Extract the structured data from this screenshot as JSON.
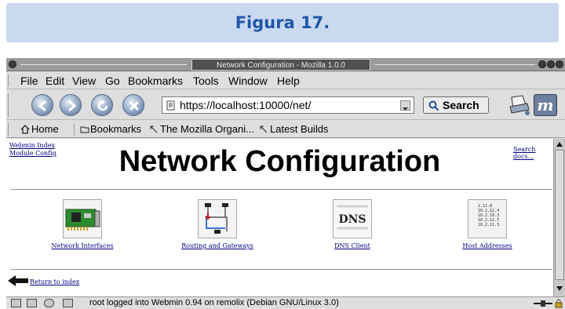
{
  "figure": {
    "caption": "Figura 17."
  },
  "window": {
    "title": "Network Configuration - Mozilla 1.0.0"
  },
  "menu": {
    "items": [
      {
        "label": "File",
        "key": "file"
      },
      {
        "label": "Edit",
        "key": "edit"
      },
      {
        "label": "View",
        "key": "view"
      },
      {
        "label": "Go",
        "key": "go"
      },
      {
        "label": "Bookmarks",
        "key": "bookmarks"
      },
      {
        "label": "Tools",
        "key": "tools"
      },
      {
        "label": "Window",
        "key": "window"
      },
      {
        "label": "Help",
        "key": "help"
      }
    ]
  },
  "navigation": {
    "url": "https://localhost:10000/net/",
    "search_label": "Search",
    "buttons": [
      "back-arrow-icon",
      "forward-arrow-icon",
      "reload-icon",
      "stop-icon"
    ]
  },
  "personal_toolbar": {
    "home": "Home",
    "bookmarks": "Bookmarks",
    "mozilla_org": "The Mozilla Organi...",
    "latest_builds": "Latest Builds"
  },
  "page": {
    "webmin_index": "Webmin Index",
    "module_config": "Module Config",
    "search_docs": "Search docs...",
    "title": "Network Configuration",
    "modules": [
      {
        "label": "Network Interfaces",
        "icon": "network-card-icon"
      },
      {
        "label": "Routing and Gateways",
        "icon": "routing-icon"
      },
      {
        "label": "DNS Client",
        "icon": "dns-icon",
        "icon_text": "DNS"
      },
      {
        "label": "Host Addresses",
        "icon": "host-addresses-icon",
        "icon_lines": [
          "2.11.8",
          "10.2.12.4",
          "10.2.10.3",
          "10.2.11.7",
          "10.2.11.3"
        ]
      }
    ],
    "return_link": "Return to index"
  },
  "status": {
    "text": "root logged into Webmin 0.94 on remolix (Debian GNU/Linux 3.0)"
  },
  "colors": {
    "caption_background": "#c9d9ef",
    "caption_text": "#1f57a8",
    "link": "#000080",
    "chrome": "#dedede",
    "titlebar": "#9b9b9b"
  }
}
